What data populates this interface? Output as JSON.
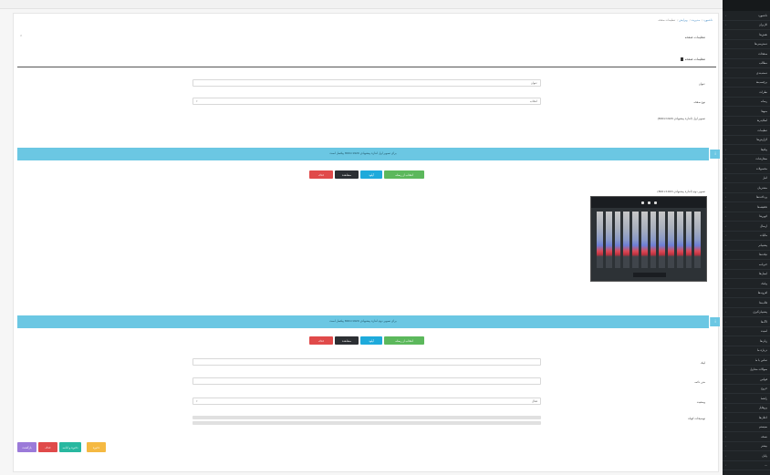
{
  "breadcrumb": [
    "داشبورد",
    "مدیریت",
    "ویرایش",
    "تنظیمات صفحه"
  ],
  "page_title": "تنظیمات صفحه",
  "section_title": "تنظیمات صفحه",
  "fields": {
    "field1_label": "عنوان",
    "field1_value": "عنوان",
    "field2_label": "نوع صفحه",
    "field2_value": "انتخاب",
    "image1_label": "تصویر اول (اندازه پیشنهادی 1920×800)",
    "image2_label": "تصویر دوم (اندازه پیشنهادی 1920×800)",
    "field3_label": "لینک",
    "field4_label": "متن دکمه",
    "field5_label": "وضعیت",
    "field5_value": "فعال",
    "field6_label": "توضیحات کوتاه"
  },
  "info_bar_1": "برای تصویر اول اندازه پیشنهادی 1920×800 پیکسل است",
  "info_bar_2": "برای تصویر دوم اندازه پیشنهادی 1920×800 پیکسل است",
  "image_buttons": {
    "choose": "انتخاب از رسانه",
    "upload": "آپلود",
    "preview": "مشاهده",
    "delete": "حذف"
  },
  "footer_buttons": {
    "save": "ذخیره",
    "delete": "حذف",
    "save_continue": "ذخیره و ادامه",
    "back": "بازگشت"
  },
  "sidebar": {
    "items": [
      "داشبورد",
      "کاربران",
      "نقش‌ها",
      "دسترسی‌ها",
      "صفحات",
      "مطالب",
      "دسته‌بندی",
      "برچسب‌ها",
      "نظرات",
      "رسانه",
      "منوها",
      "اسلایدرها",
      "تنظیمات",
      "گزارش‌ها",
      "پیام‌ها",
      "سفارشات",
      "محصولات",
      "انبار",
      "مشتریان",
      "پرداخت‌ها",
      "تخفیف‌ها",
      "کوپن‌ها",
      "ارسال",
      "مالیات",
      "پشتیبانی",
      "تیکت‌ها",
      "خبرنامه",
      "ایمیل‌ها",
      "پیامک",
      "افزونه‌ها",
      "قالب‌ها",
      "پشتیبان‌گیری",
      "لاگ‌ها",
      "امنیت",
      "زبان‌ها",
      "درباره ما",
      "تماس با ما",
      "سوالات متداول",
      "قوانین",
      "خروج",
      "راهنما",
      "پروفایل",
      "اعلان‌ها",
      "سیستم",
      "نسخه",
      "بیشتر",
      "پایان",
      "—",
      "—"
    ]
  }
}
